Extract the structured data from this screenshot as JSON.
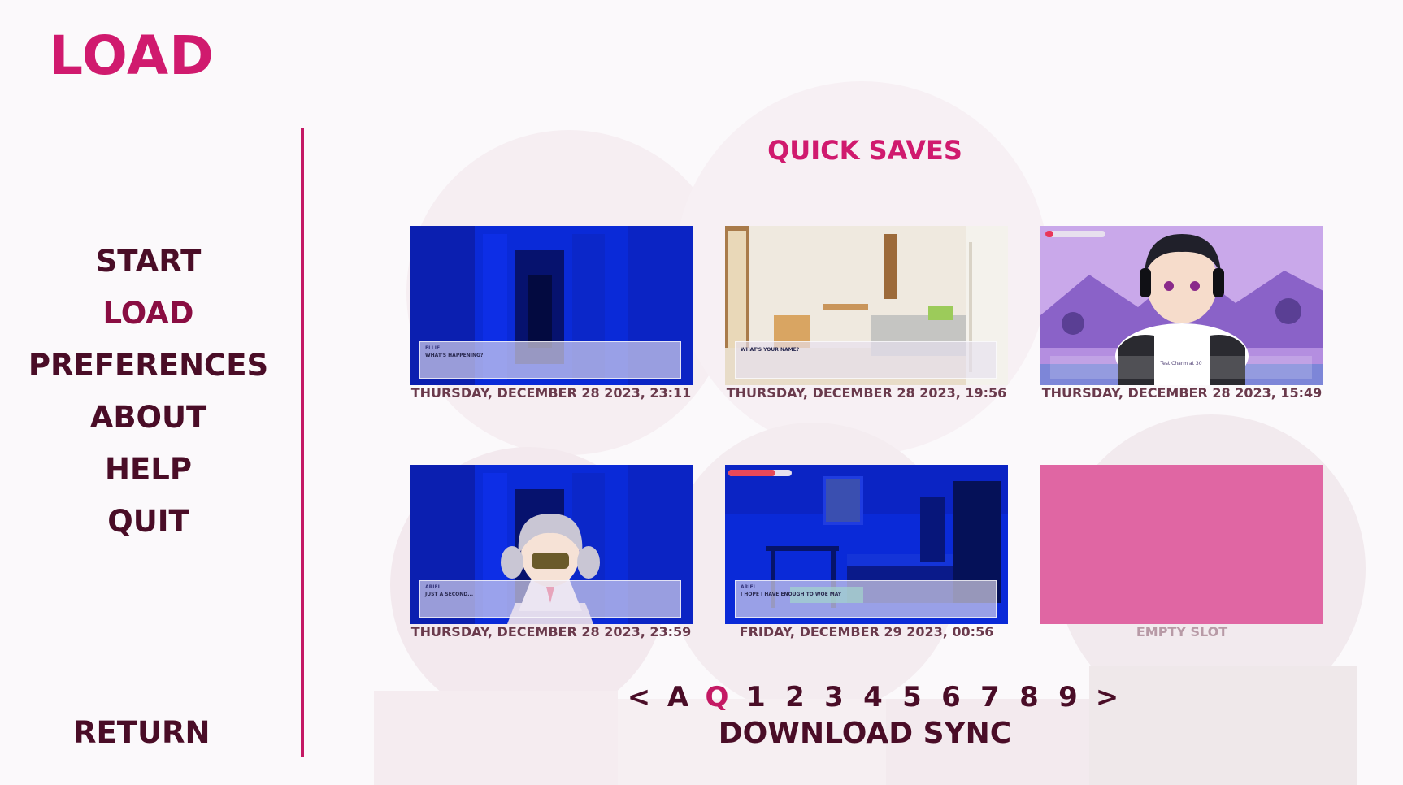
{
  "screen": {
    "title": "LOAD"
  },
  "nav": {
    "items": [
      {
        "label": "START",
        "active": false
      },
      {
        "label": "LOAD",
        "active": true
      },
      {
        "label": "PREFERENCES",
        "active": false
      },
      {
        "label": "ABOUT",
        "active": false
      },
      {
        "label": "HELP",
        "active": false
      },
      {
        "label": "QUIT",
        "active": false
      }
    ],
    "return_label": "RETURN"
  },
  "saves": {
    "section_title": "QUICK SAVES",
    "slots": [
      {
        "caption": "THURSDAY, DECEMBER 28 2023, 23:11",
        "scene": "hallway",
        "speaker": "ELLIE",
        "line": "WHAT'S HAPPENING?",
        "empty": false
      },
      {
        "caption": "THURSDAY, DECEMBER 28 2023, 19:56",
        "scene": "living-room",
        "speaker": "",
        "line": "WHAT'S YOUR NAME?",
        "empty": false
      },
      {
        "caption": "THURSDAY, DECEMBER 28 2023, 15:49",
        "scene": "character-headphones",
        "speaker": "",
        "line": "Test Charm at 30",
        "empty": false
      },
      {
        "caption": "THURSDAY, DECEMBER 28 2023, 23:59",
        "scene": "hallway-character",
        "speaker": "ARIEL",
        "line": "JUST A SECOND...",
        "empty": false
      },
      {
        "caption": "FRIDAY, DECEMBER 29 2023, 00:56",
        "scene": "bedroom",
        "speaker": "ARIEL",
        "line": "I HOPE I HAVE ENOUGH TO WOE MAY",
        "empty": false
      },
      {
        "caption": "EMPTY SLOT",
        "scene": "empty",
        "speaker": "",
        "line": "",
        "empty": true
      }
    ]
  },
  "pager": {
    "items": [
      "<",
      "A",
      "Q",
      "1",
      "2",
      "3",
      "4",
      "5",
      "6",
      "7",
      "8",
      "9",
      ">"
    ],
    "active": "Q"
  },
  "sync_label": "DOWNLOAD SYNC",
  "colors": {
    "accent": "#d01a6e",
    "text_dark": "#4a0d27",
    "empty_slot": "#e066a3",
    "night_blue": "#0a2ad8"
  }
}
